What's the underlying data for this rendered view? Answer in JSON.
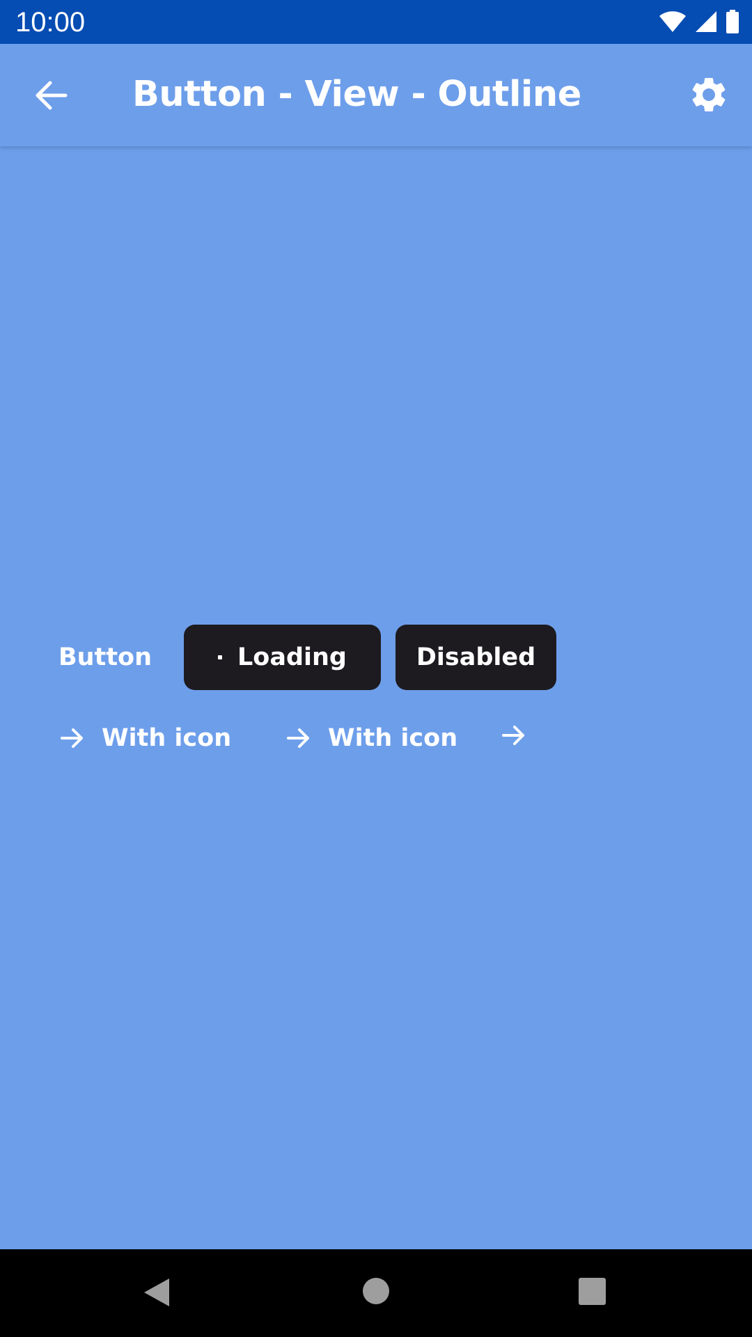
{
  "status_bar": {
    "time": "10:00",
    "background": "#054cb3",
    "icons": [
      "wifi-icon",
      "signal-icon",
      "battery-icon"
    ]
  },
  "app_bar": {
    "title": "Button - View - Outline",
    "back_icon": "arrow-back-icon",
    "settings_icon": "gear-icon"
  },
  "buttons": {
    "row1": {
      "plain_label": "Button",
      "loading_label": "Loading",
      "disabled_label": "Disabled"
    },
    "row2": {
      "with_icon_1_label": "With icon",
      "with_icon_2_label": "With icon",
      "icon": "arrow-forward-icon"
    }
  },
  "nav_bar": {
    "icons": [
      "nav-back-icon",
      "nav-home-icon",
      "nav-recents-icon"
    ]
  },
  "colors": {
    "background": "#6d9eea",
    "dark_button": "#1d1b20",
    "text": "#ffffff"
  }
}
